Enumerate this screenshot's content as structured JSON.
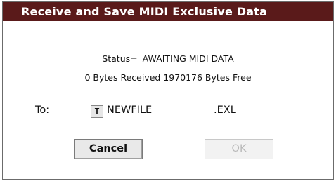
{
  "dialog": {
    "title": "Receive and Save MIDI Exclusive Data",
    "status_label": "Status=",
    "status_value": "AWAITING MIDI DATA",
    "bytes_line": "0 Bytes Received 1970176 Bytes Free",
    "to_label": "To:",
    "text_edit_glyph": "T",
    "filename": "NEWFILE",
    "extension": ".EXL",
    "cancel_label": "Cancel",
    "ok_label": "OK",
    "ok_enabled": false
  },
  "colors": {
    "titlebar": "#5a1a1a",
    "title_text": "#ffffff",
    "disabled_text": "#b8b8b8"
  }
}
